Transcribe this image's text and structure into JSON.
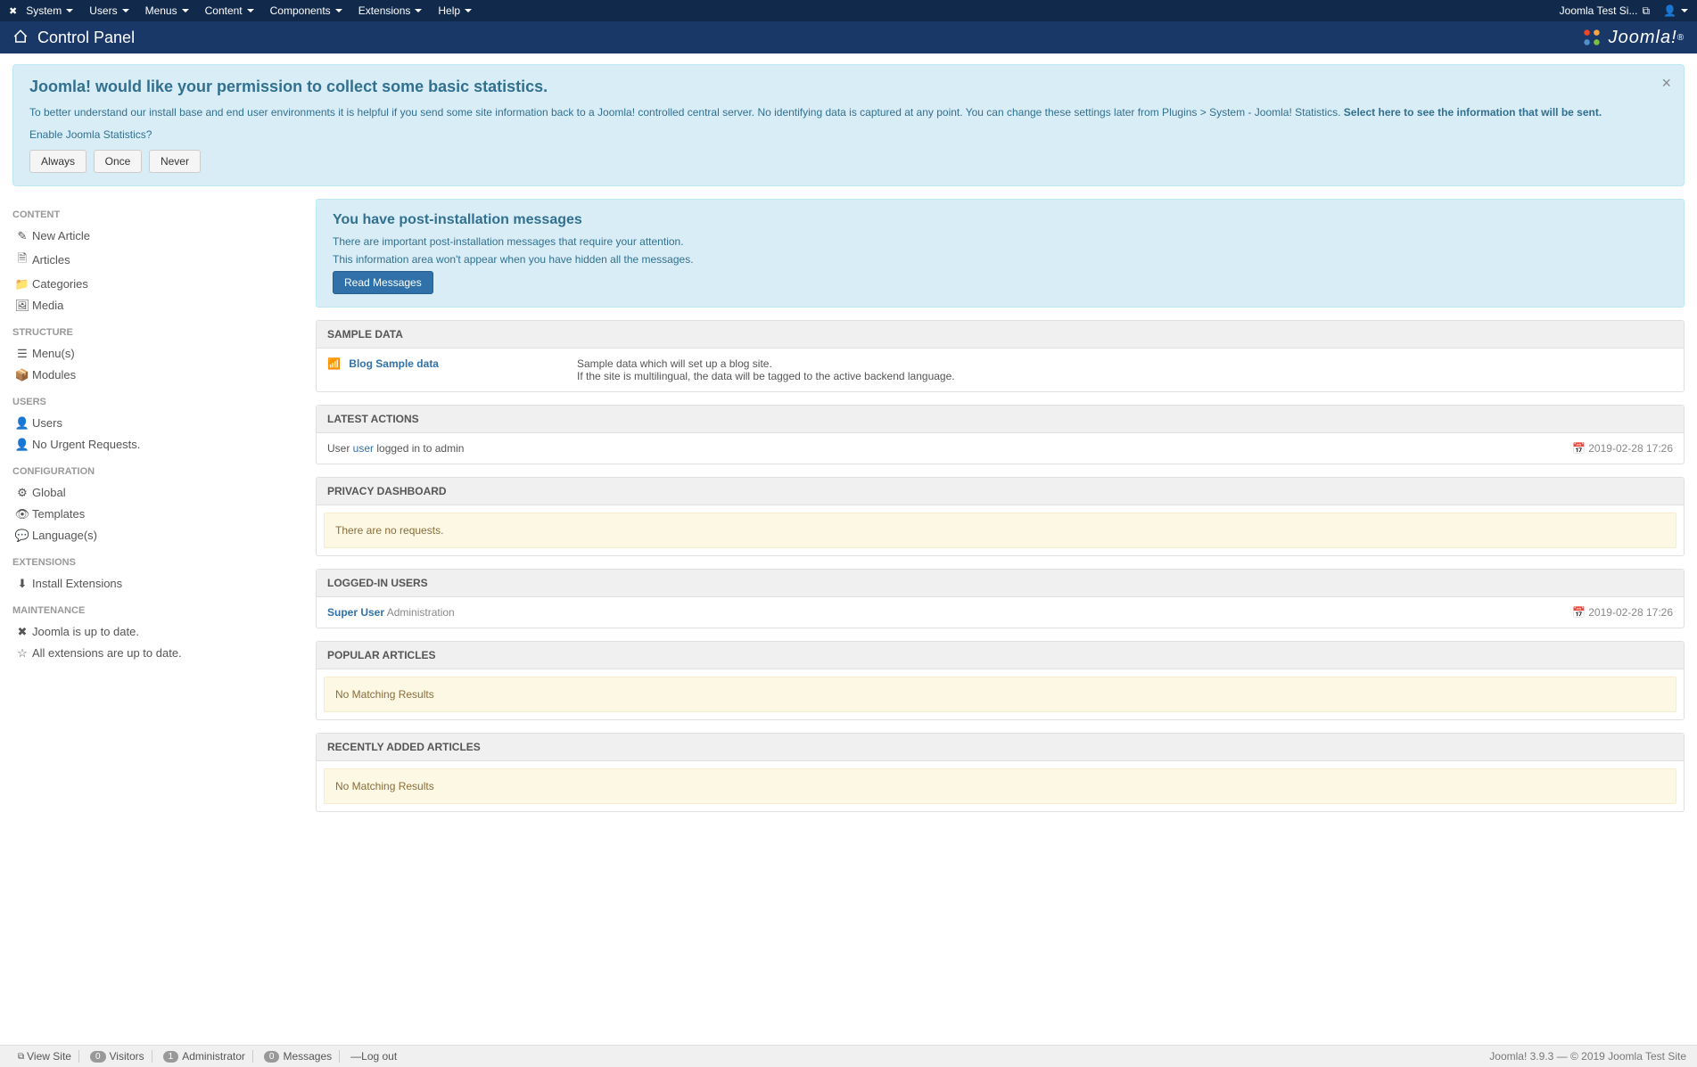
{
  "topbar": {
    "menus": [
      "System",
      "Users",
      "Menus",
      "Content",
      "Components",
      "Extensions",
      "Help"
    ],
    "site_name": "Joomla Test Si..."
  },
  "header": {
    "title": "Control Panel",
    "logo_text": "Joomla!"
  },
  "stats_alert": {
    "title": "Joomla! would like your permission to collect some basic statistics.",
    "body1": "To better understand our install base and end user environments it is helpful if you send some site information back to a Joomla! controlled central server. No identifying data is captured at any point. You can change these settings later from Plugins > System - Joomla! Statistics. ",
    "body1_bold": "Select here to see the information that will be sent.",
    "enable_link": "Enable Joomla Statistics?",
    "btn_always": "Always",
    "btn_once": "Once",
    "btn_never": "Never"
  },
  "sidebar": {
    "sections": [
      {
        "title": "CONTENT",
        "items": [
          {
            "icon": "✎",
            "label": "New Article"
          },
          {
            "icon": "🗎",
            "label": "Articles"
          },
          {
            "icon": "📁",
            "label": "Categories"
          },
          {
            "icon": "🖼",
            "label": "Media"
          }
        ]
      },
      {
        "title": "STRUCTURE",
        "items": [
          {
            "icon": "☰",
            "label": "Menu(s)"
          },
          {
            "icon": "📦",
            "label": "Modules"
          }
        ]
      },
      {
        "title": "USERS",
        "items": [
          {
            "icon": "👤",
            "label": "Users"
          },
          {
            "icon": "👤",
            "label": "No Urgent Requests."
          }
        ]
      },
      {
        "title": "CONFIGURATION",
        "items": [
          {
            "icon": "⚙",
            "label": "Global"
          },
          {
            "icon": "👁",
            "label": "Templates"
          },
          {
            "icon": "💬",
            "label": "Language(s)"
          }
        ]
      },
      {
        "title": "EXTENSIONS",
        "items": [
          {
            "icon": "⬇",
            "label": "Install Extensions"
          }
        ]
      },
      {
        "title": "MAINTENANCE",
        "items": [
          {
            "icon": "✖",
            "label": "Joomla is up to date."
          },
          {
            "icon": "☆",
            "label": "All extensions are up to date."
          }
        ]
      }
    ]
  },
  "post_install": {
    "title": "You have post-installation messages",
    "line1": "There are important post-installation messages that require your attention.",
    "line2": "This information area won't appear when you have hidden all the messages.",
    "button": "Read Messages"
  },
  "panels": {
    "sample_data": {
      "title": "SAMPLE DATA",
      "item_title": "Blog Sample data",
      "item_desc1": "Sample data which will set up a blog site.",
      "item_desc2": "If the site is multilingual, the data will be tagged to the active backend language."
    },
    "latest_actions": {
      "title": "LATEST ACTIONS",
      "prefix": "User ",
      "user": "user",
      "suffix": " logged in to admin",
      "timestamp": "2019-02-28 17:26"
    },
    "privacy": {
      "title": "PRIVACY DASHBOARD",
      "message": "There are no requests."
    },
    "logged_in": {
      "title": "LOGGED-IN USERS",
      "user": "Super User",
      "location": "Administration",
      "timestamp": "2019-02-28 17:26"
    },
    "popular": {
      "title": "POPULAR ARTICLES",
      "message": "No Matching Results"
    },
    "recent": {
      "title": "RECENTLY ADDED ARTICLES",
      "message": "No Matching Results"
    }
  },
  "footer": {
    "view_site": "View Site",
    "visitors_count": "0",
    "visitors_label": "Visitors",
    "admin_count": "1",
    "admin_label": "Administrator",
    "messages_count": "0",
    "messages_label": "Messages",
    "logout": "Log out",
    "right": "Joomla! 3.9.3 — © 2019 Joomla Test Site"
  }
}
